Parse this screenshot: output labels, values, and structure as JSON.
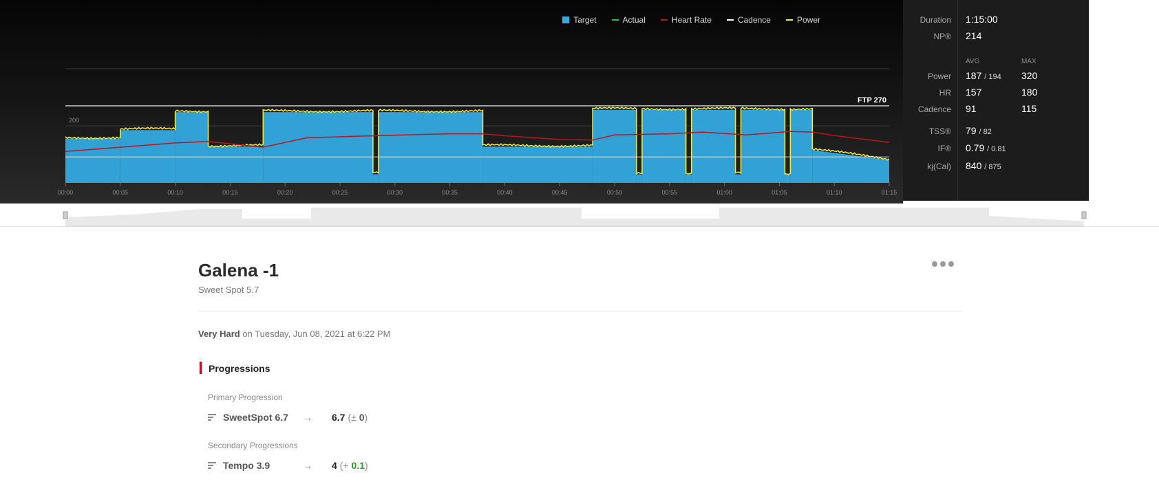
{
  "colors": {
    "target": "#33a9e0",
    "actual": "#22cc22",
    "heart_rate": "#c0141b",
    "cadence": "#ffffff",
    "power": "#f3ef3a",
    "accent": "#d0021b",
    "positive_delta": "#2a9c2a"
  },
  "legend": [
    {
      "label": "Target",
      "color": "#33a9e0",
      "shape": "square"
    },
    {
      "label": "Actual",
      "color": "#22cc22",
      "shape": "line"
    },
    {
      "label": "Heart Rate",
      "color": "#c0141b",
      "shape": "line"
    },
    {
      "label": "Cadence",
      "color": "#ffffff",
      "shape": "line"
    },
    {
      "label": "Power",
      "color": "#f3ef3a",
      "shape": "line"
    }
  ],
  "chart_data": {
    "type": "area",
    "ftp_label": "FTP 270",
    "ftp_value": 270,
    "y_label_tick": "200",
    "ylim": [
      0,
      400
    ],
    "x_ticks": [
      "00:00",
      "00:05",
      "00:10",
      "00:15",
      "00:20",
      "00:25",
      "00:30",
      "00:35",
      "00:40",
      "00:45",
      "00:50",
      "00:55",
      "01:00",
      "01:05",
      "01:10",
      "01:15"
    ],
    "x_max_minutes": 75,
    "target_segments": [
      {
        "start": 0,
        "end": 5,
        "from": 155,
        "to": 155
      },
      {
        "start": 5,
        "end": 10,
        "from": 185,
        "to": 185
      },
      {
        "start": 10,
        "end": 13,
        "from": 248,
        "to": 248
      },
      {
        "start": 13,
        "end": 18,
        "from": 127,
        "to": 127
      },
      {
        "start": 18,
        "end": 28,
        "from": 248,
        "to": 248
      },
      {
        "start": 28,
        "end": 28.5,
        "from": 30,
        "to": 30
      },
      {
        "start": 28.5,
        "end": 38,
        "from": 248,
        "to": 248
      },
      {
        "start": 38,
        "end": 48,
        "from": 127,
        "to": 127
      },
      {
        "start": 48,
        "end": 52,
        "from": 256,
        "to": 256
      },
      {
        "start": 52,
        "end": 52.5,
        "from": 30,
        "to": 30
      },
      {
        "start": 52.5,
        "end": 56.5,
        "from": 256,
        "to": 256
      },
      {
        "start": 56.5,
        "end": 57,
        "from": 30,
        "to": 30
      },
      {
        "start": 57,
        "end": 61,
        "from": 256,
        "to": 256
      },
      {
        "start": 61,
        "end": 61.5,
        "from": 30,
        "to": 30
      },
      {
        "start": 61.5,
        "end": 65.5,
        "from": 256,
        "to": 256
      },
      {
        "start": 65.5,
        "end": 66,
        "from": 30,
        "to": 30
      },
      {
        "start": 66,
        "end": 68,
        "from": 256,
        "to": 256
      },
      {
        "start": 68,
        "end": 75,
        "from": 115,
        "to": 80
      }
    ],
    "heart_rate_points": [
      [
        0,
        110
      ],
      [
        5,
        125
      ],
      [
        10,
        140
      ],
      [
        13,
        145
      ],
      [
        18,
        125
      ],
      [
        22,
        158
      ],
      [
        28,
        165
      ],
      [
        35,
        172
      ],
      [
        38,
        172
      ],
      [
        40,
        165
      ],
      [
        45,
        152
      ],
      [
        48,
        150
      ],
      [
        50,
        168
      ],
      [
        55,
        172
      ],
      [
        58,
        178
      ],
      [
        62,
        168
      ],
      [
        66,
        180
      ],
      [
        68,
        178
      ],
      [
        70,
        166
      ],
      [
        75,
        142
      ]
    ],
    "cadence_value": 91,
    "power_avg": 187,
    "power_max": 320
  },
  "stats": {
    "duration_label": "Duration",
    "duration_value": "1:15:00",
    "np_label": "NP®",
    "np_value": "214",
    "avg_head": "AVG",
    "max_head": "MAX",
    "power_label": "Power",
    "power_avg": "187",
    "power_avg_sub": "194",
    "power_max": "320",
    "hr_label": "HR",
    "hr_avg": "157",
    "hr_max": "180",
    "cadence_label": "Cadence",
    "cadence_avg": "91",
    "cadence_max": "115",
    "tss_label": "TSS®",
    "tss_value": "79",
    "tss_sub": "82",
    "if_label": "IF®",
    "if_value": "0.79",
    "if_sub": "0.81",
    "kj_label": "kj(Cal)",
    "kj_value": "840",
    "kj_sub": "875"
  },
  "workout": {
    "title": "Galena -1",
    "subtitle": "Sweet Spot 5.7",
    "effort": "Very Hard",
    "date_text": "on Tuesday, Jun 08, 2021 at 6:22 PM"
  },
  "progressions": {
    "title": "Progressions",
    "primary_label": "Primary Progression",
    "primary": {
      "name": "SweetSpot 6.7",
      "arrow": "→",
      "new_value": "6.7",
      "delta_open": "(",
      "delta_sign": "± ",
      "delta": "0",
      "delta_close": ")"
    },
    "secondary_label": "Secondary Progressions",
    "secondary": {
      "name": "Tempo 3.9",
      "arrow": "→",
      "new_value": "4",
      "delta_open": "(",
      "delta_sign": "+ ",
      "delta": "0.1",
      "delta_close": ")"
    }
  }
}
